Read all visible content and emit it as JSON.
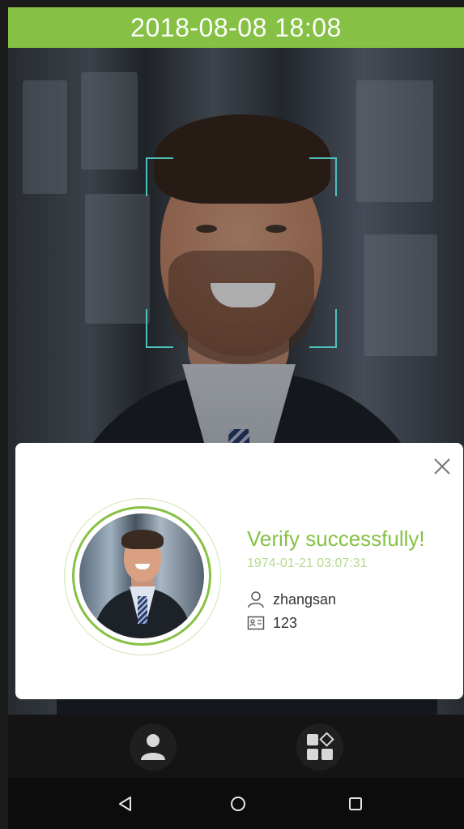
{
  "status_bar": {
    "datetime": "2018-08-08 18:08"
  },
  "dialog": {
    "title": "Verify successfully!",
    "timestamp": "1974-01-21 03:07:31",
    "user_name": "zhangsan",
    "user_id": "123",
    "close_icon": "close-icon"
  },
  "bottom_bar": {
    "left_icon": "person-icon",
    "right_icon": "menu-grid-icon"
  },
  "nav_bar": {
    "back_icon": "back-triangle-icon",
    "home_icon": "home-circle-icon",
    "recent_icon": "recent-square-icon"
  },
  "colors": {
    "accent_green": "#86c145",
    "light_green": "#b5d98e",
    "frame_teal": "#4fc1bd"
  }
}
